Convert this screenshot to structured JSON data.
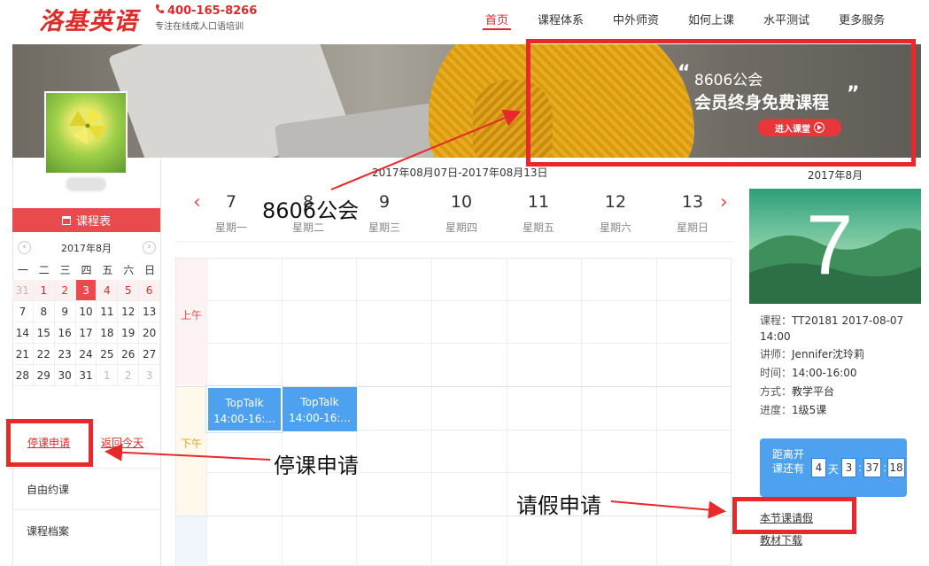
{
  "header": {
    "logo": "洛基英语",
    "phone": "400-165-8266",
    "slogan": "专注在线成人口语培训",
    "nav": [
      "首页",
      "课程体系",
      "中外师资",
      "如何上课",
      "水平测试",
      "更多服务"
    ]
  },
  "banner": {
    "line1": "8606公会",
    "line2": "会员终身免费课程",
    "quote_open": "“",
    "quote_close": "”",
    "enter_label": "进入课堂"
  },
  "sidebar": {
    "schedule_label": "课程表",
    "mini_calendar": {
      "month": "2017年8月",
      "prev": "‹",
      "next": "›",
      "weekdays": [
        "一",
        "二",
        "三",
        "四",
        "五",
        "六",
        "日"
      ],
      "weeks": [
        [
          "31",
          "1",
          "2",
          "3",
          "4",
          "5",
          "6"
        ],
        [
          "7",
          "8",
          "9",
          "10",
          "11",
          "12",
          "13"
        ],
        [
          "14",
          "15",
          "16",
          "17",
          "18",
          "19",
          "20"
        ],
        [
          "21",
          "22",
          "23",
          "24",
          "25",
          "26",
          "27"
        ],
        [
          "28",
          "29",
          "30",
          "31",
          "1",
          "2",
          "3"
        ]
      ]
    },
    "stop_class": "停课申请",
    "back_today": "返回今天",
    "links": [
      "自由约课",
      "课程档案"
    ]
  },
  "week": {
    "range": "2017年08月07日-2017年08月13日",
    "days": [
      {
        "num": "7",
        "name": "星期一"
      },
      {
        "num": "8",
        "name": "星期二"
      },
      {
        "num": "9",
        "name": "星期三"
      },
      {
        "num": "10",
        "name": "星期四"
      },
      {
        "num": "11",
        "name": "星期五"
      },
      {
        "num": "12",
        "name": "星期六"
      },
      {
        "num": "13",
        "name": "星期日"
      }
    ],
    "prev": "‹",
    "next": "›"
  },
  "timetable": {
    "am_label": "上午",
    "pm_label": "下午",
    "courses": [
      {
        "title": "TopTalk",
        "time": "14:00-16:..."
      },
      {
        "title": "TopTalk",
        "time": "14:00-16:..."
      }
    ]
  },
  "detail": {
    "month": "2017年8月",
    "day": "7",
    "course_label": "课程：",
    "course_value": "TT20181 2017-08-07 14:00",
    "teacher_label": "讲师：",
    "teacher_value": "Jennifer沈玲莉",
    "time_label": "时间：",
    "time_value": "14:00-16:00",
    "mode_label": "方式：",
    "mode_value": "教学平台",
    "progress_label": "进度：",
    "progress_value": "1级5课",
    "countdown_label": "距离开课还有",
    "countdown_days": "4",
    "countdown_day_unit": "天",
    "countdown_h": "3",
    "countdown_m": "37",
    "countdown_s": "18",
    "leave_link": "本节课请假",
    "material_link": "教材下载"
  },
  "annotations": {
    "guild_text": "8606公会",
    "stop_text": "停课申请",
    "leave_text": "请假申请"
  },
  "colors": {
    "brand_red": "#e84a4e",
    "course_blue": "#4da1ef",
    "annotation_red": "#e8282b"
  }
}
